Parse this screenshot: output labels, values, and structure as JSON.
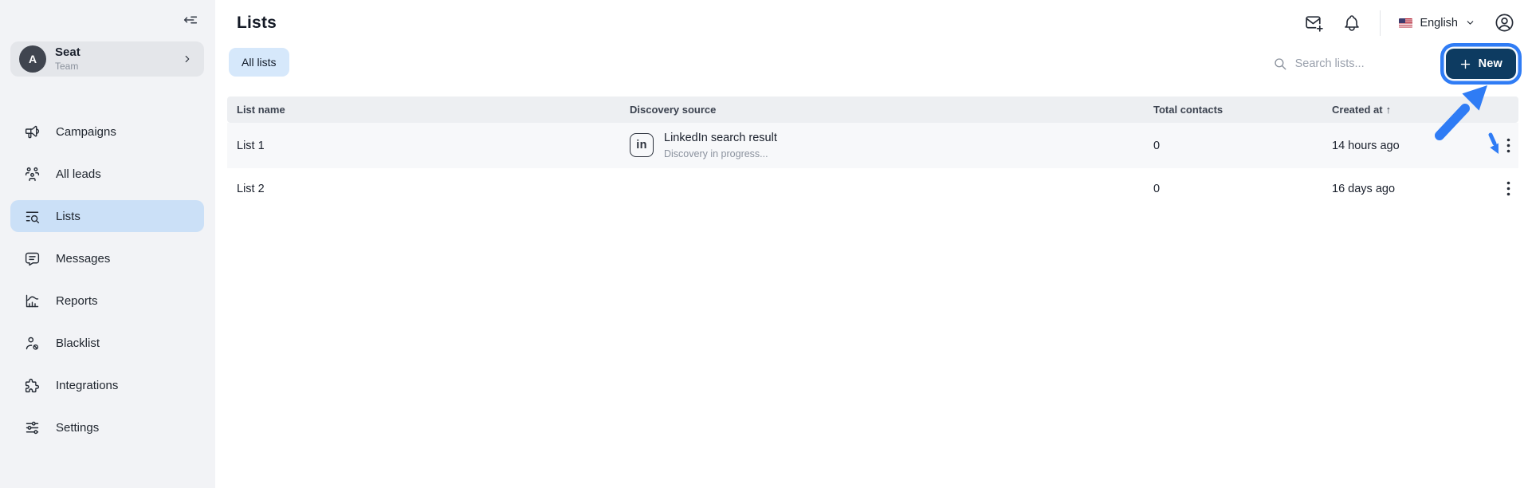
{
  "sidebar": {
    "team": {
      "avatar_initial": "A",
      "name": "Seat",
      "role": "Team"
    },
    "items": [
      {
        "label": "Campaigns",
        "icon": "megaphone-icon"
      },
      {
        "label": "All leads",
        "icon": "users-group-icon"
      },
      {
        "label": "Lists",
        "icon": "list-search-icon",
        "active": true
      },
      {
        "label": "Messages",
        "icon": "message-bubble-icon"
      },
      {
        "label": "Reports",
        "icon": "bar-chart-icon"
      },
      {
        "label": "Blacklist",
        "icon": "user-blocked-icon"
      },
      {
        "label": "Integrations",
        "icon": "puzzle-piece-icon"
      },
      {
        "label": "Settings",
        "icon": "sliders-icon"
      }
    ]
  },
  "header": {
    "title": "Lists",
    "language": "English"
  },
  "toolbar": {
    "all_lists_tab": "All lists",
    "search_placeholder": "Search lists...",
    "new_button_label": "New"
  },
  "table": {
    "columns": [
      "List name",
      "Discovery source",
      "Total contacts",
      "Created at"
    ],
    "sort_indicator": "↑",
    "rows": [
      {
        "name": "List 1",
        "source_icon_text": "in",
        "source_title": "LinkedIn search result",
        "source_subtitle": "Discovery in progress...",
        "total_contacts": "0",
        "created_at": "14 hours ago"
      },
      {
        "name": "List 2",
        "total_contacts": "0",
        "created_at": "16 days ago"
      }
    ]
  },
  "annotations": {
    "highlight_target": "new-button",
    "arrow_color": "#2f7cf5"
  },
  "colors": {
    "accent_blue": "#2f7cf5",
    "new_button_navy": "#0d3b61",
    "active_nav_bg": "#cbe0f7",
    "chip_bg": "#d6e8fb",
    "sidebar_bg": "#f2f3f6"
  }
}
